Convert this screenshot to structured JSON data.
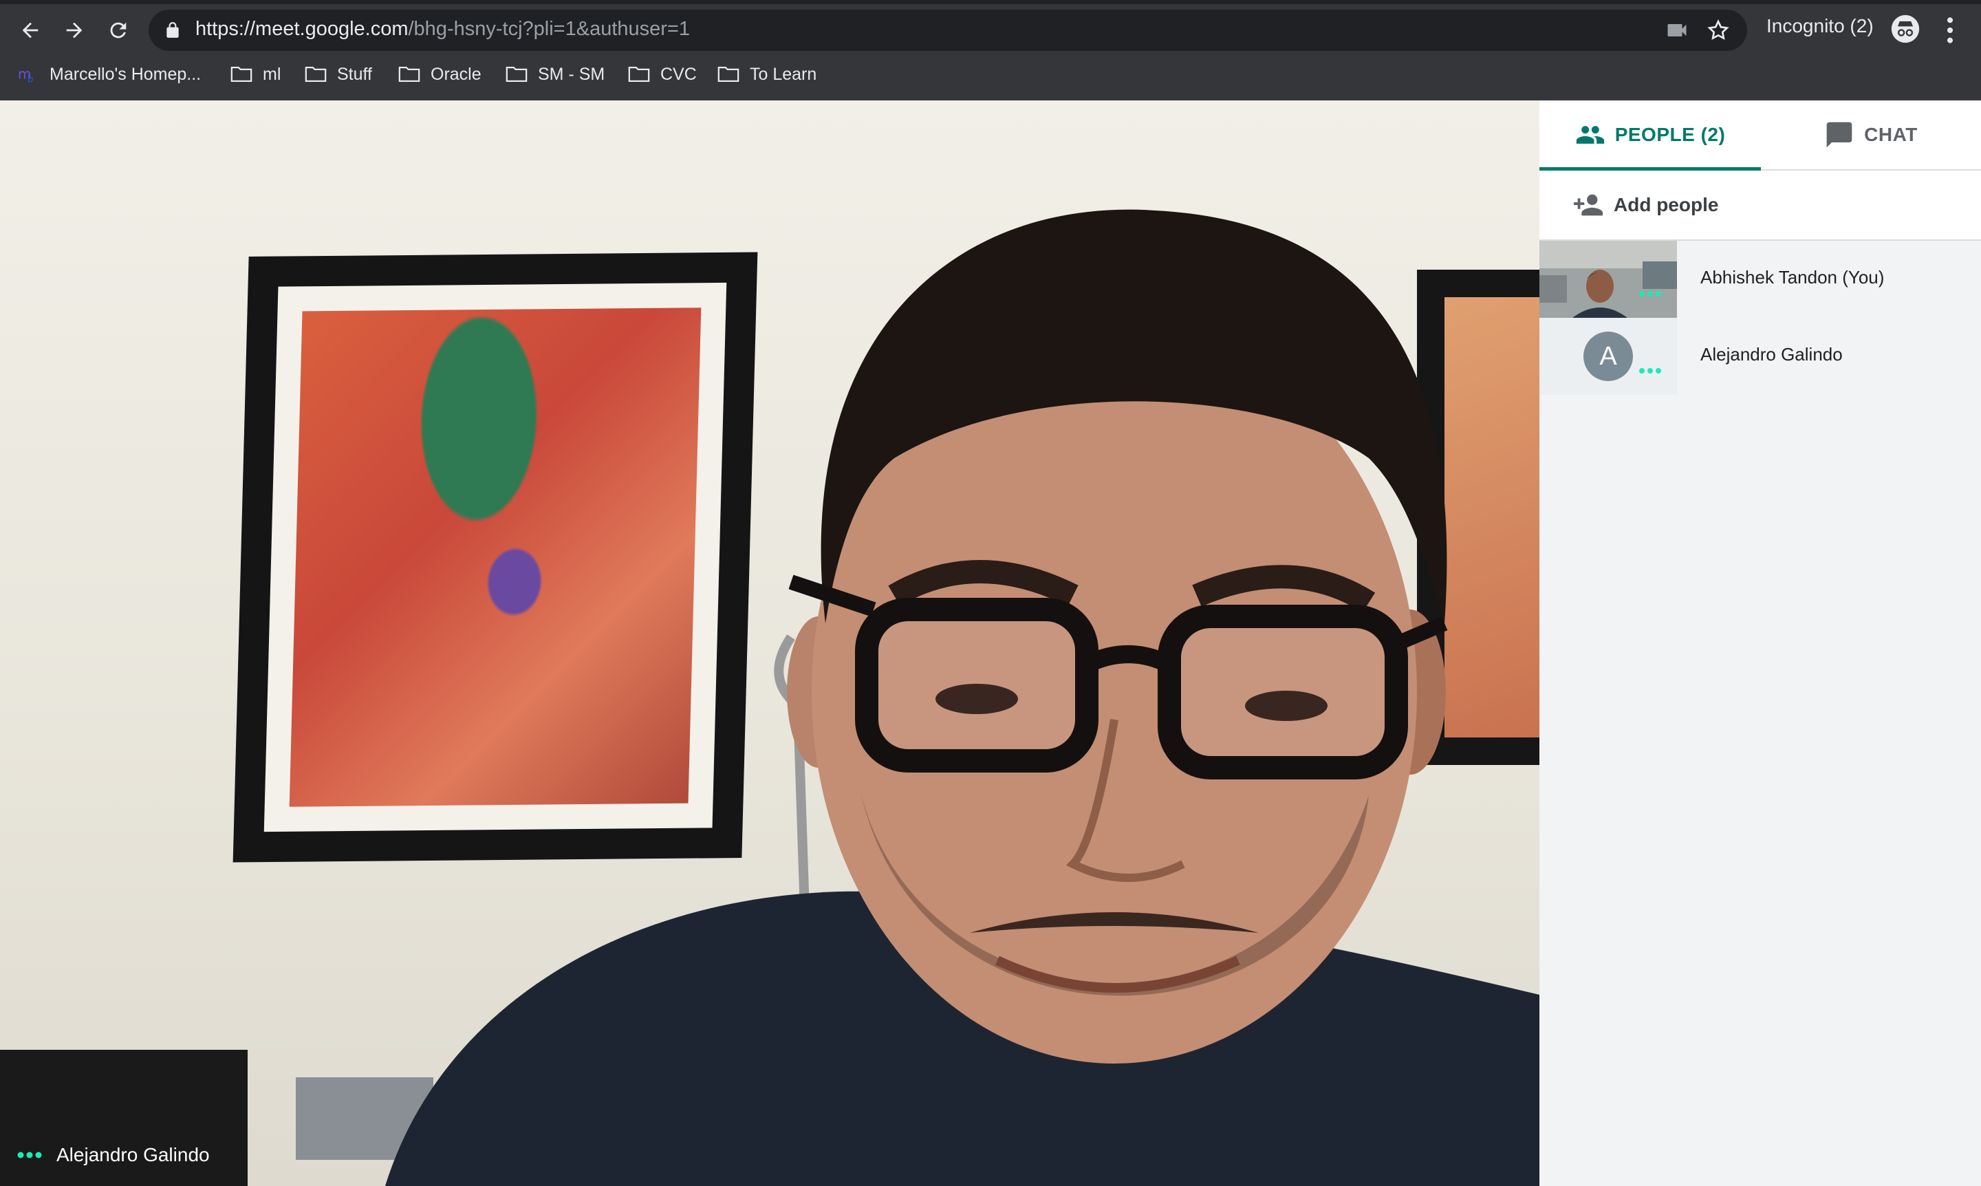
{
  "browser": {
    "url_host": "https://meet.google.com",
    "url_path": "/bhg-hsny-tcj?pli=1&authuser=1",
    "incognito_label": "Incognito (2)",
    "bookmarks": [
      {
        "label": "Marcello's Homep...",
        "icon": "site-favicon"
      },
      {
        "label": "ml",
        "icon": "folder-icon"
      },
      {
        "label": "Stuff",
        "icon": "folder-icon"
      },
      {
        "label": "Oracle",
        "icon": "folder-icon"
      },
      {
        "label": "SM - SM",
        "icon": "folder-icon"
      },
      {
        "label": "CVC",
        "icon": "folder-icon"
      },
      {
        "label": "To Learn",
        "icon": "folder-icon"
      }
    ]
  },
  "video": {
    "participant_name": "Alejandro Galindo"
  },
  "panel": {
    "tabs": [
      {
        "label": "PEOPLE (2)",
        "icon": "people-icon",
        "active": true
      },
      {
        "label": "CHAT",
        "icon": "chat-icon",
        "active": false
      }
    ],
    "add_people_label": "Add people",
    "participants": [
      {
        "name": "Abhishek Tandon (You)",
        "thumb": "video"
      },
      {
        "name": "Alejandro Galindo",
        "avatar_letter": "A"
      }
    ]
  },
  "colors": {
    "accent": "#00796b",
    "chrome": "#35363a",
    "omnibox": "#202124",
    "active_dots": "#1de9b6"
  }
}
